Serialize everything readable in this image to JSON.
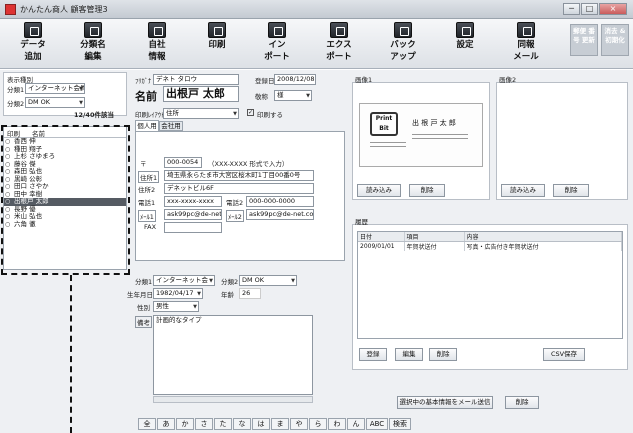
{
  "window": {
    "title": "かんたん商人 顧客管理3",
    "min": "─",
    "max": "□",
    "close": "×"
  },
  "toolbar": [
    {
      "label1": "データ",
      "label2": "追加"
    },
    {
      "label1": "分類名",
      "label2": "編集"
    },
    {
      "label1": "自社",
      "label2": "情報"
    },
    {
      "label1": "印刷",
      "label2": ""
    },
    {
      "label1": "イン",
      "label2": "ポート"
    },
    {
      "label1": "エクス",
      "label2": "ポート"
    },
    {
      "label1": "バック",
      "label2": "アップ"
    },
    {
      "label1": "設定",
      "label2": ""
    },
    {
      "label1": "同報",
      "label2": "メール"
    }
  ],
  "side_buttons": [
    {
      "label": "郵便 番号 更新"
    },
    {
      "label": "消去 & 初期化"
    }
  ],
  "filter": {
    "group_label": "表示種別",
    "cat1_label": "分類1",
    "cat1_value": "インターネット会員",
    "cat2_label": "分類2",
    "cat2_value": "DM OK",
    "count": "12/40件該当"
  },
  "list": {
    "col_print": "印刷",
    "col_name": "名前",
    "names": [
      "香西 伸",
      "種田 翔子",
      "上杉 さゆまろ",
      "藤谷 傑",
      "森田 弘也",
      "黒崎 公彰",
      "田口 さやか",
      "田中 幸樹",
      "出根戸 太郎",
      "長野 優",
      "米山 弘也",
      "六角 徹"
    ],
    "selected_index": 8
  },
  "customer": {
    "furigana_label": "ﾌﾘｶﾞﾅ",
    "furigana": "デネト タロウ",
    "reg_label": "登録日",
    "reg_date": "2008/12/08",
    "name_label": "名前",
    "name": "出根戸 太郎",
    "honorific_label": "敬称",
    "honorific": "様",
    "layout_label": "印刷ﾚｲｱｳﾄ",
    "layout": "住所",
    "print_check": "印刷する",
    "tab_personal": "個人用",
    "tab_company": "会社用",
    "zip_label": "〒",
    "zip": "000-0054",
    "zip_hint": "（XXX-XXXX 形式で入力）",
    "addr1_label": "住所1",
    "addr1": "埼玉県永らたま市大宮区桜木町1丁目00番0号",
    "addr2_label": "住所2",
    "addr2": "デネットビル6F",
    "tel1_label": "電話1",
    "tel1": "xxx-xxxx-xxxx",
    "tel2_label": "電話2",
    "tel2": "000-000-0000",
    "mail1_label": "ﾒｰﾙ1",
    "mail1": "ask99pc@de-net.com",
    "mail2_label": "ﾒｰﾙ2",
    "mail2": "ask99pc@de-net.com",
    "fax_label": "FAX",
    "fax": ""
  },
  "lower": {
    "cat1_label": "分類1",
    "cat1": "インターネット会",
    "cat2_label": "分類2",
    "cat2": "DM OK",
    "birth_label": "生年月日",
    "birth": "1982/04/17",
    "age_label": "年齢",
    "age": "26",
    "gender_label": "性別",
    "gender": "男性",
    "memo_label": "備考",
    "memo": "計画的なタイプ"
  },
  "image1": {
    "title": "画像1",
    "card_company": "Print Bit",
    "card_name": "出 根 戸  太 郎",
    "load": "読み込み",
    "delete": "削除"
  },
  "image2": {
    "title": "画像2",
    "load": "読み込み",
    "delete": "削除"
  },
  "history": {
    "title": "履歴",
    "headers": [
      "日付",
      "項目",
      "内容"
    ],
    "rows": [
      {
        "date": "2009/01/01",
        "item": "年賀状送付",
        "content": "写真・広告付き年賀状送付"
      }
    ],
    "register": "登録",
    "edit": "編集",
    "delete": "削除",
    "csv": "CSV保存"
  },
  "bottom": {
    "send_mail": "選択中の基本情報をメール送信",
    "delete": "削除"
  },
  "kana": [
    "全",
    "あ",
    "か",
    "さ",
    "た",
    "な",
    "は",
    "ま",
    "や",
    "ら",
    "わ",
    "ん",
    "ABC",
    "検索"
  ]
}
